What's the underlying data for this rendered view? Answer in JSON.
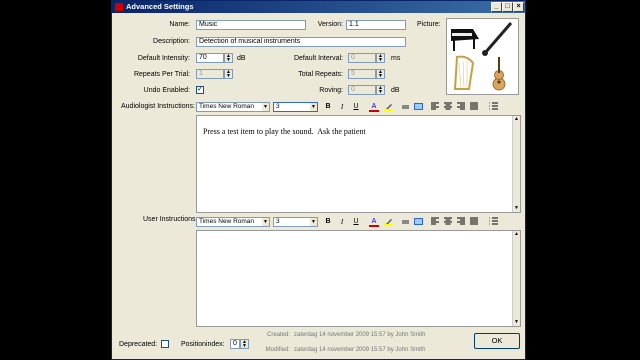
{
  "window": {
    "title": "Advanced Settings"
  },
  "form": {
    "name_label": "Name:",
    "name_value": "Music",
    "version_label": "Version:",
    "version_value": "1.1",
    "picture_label": "Picture:",
    "description_label": "Description:",
    "description_value": "Detection of musical instruments",
    "default_intensity_label": "Default Intensity:",
    "default_intensity_value": "70",
    "intensity_unit": "dB",
    "default_interval_label": "Default Interval:",
    "default_interval_value": "0",
    "interval_unit": "ms",
    "repeats_per_trial_label": "Repeats Per Trial:",
    "repeats_per_trial_value": "1",
    "total_repeats_label": "Total Repeats:",
    "total_repeats_value": "5",
    "undo_enabled_label": "Undo Enabled:",
    "undo_check": "✓",
    "roving_label": "Roving:",
    "roving_value": "0",
    "roving_unit": "dB"
  },
  "audiologist": {
    "label": "Audiologist Instructions:",
    "font": "Times New Roman",
    "size": "3",
    "text": "Press a test item to play the sound.  Ask the patient "
  },
  "user": {
    "label": "User Instructions:",
    "font": "Times New Roman",
    "size": "3",
    "text": ""
  },
  "toolbar": {
    "bold": "B",
    "italic": "I",
    "underline": "U",
    "font_color": "A"
  },
  "footer": {
    "deprecated_label": "Deprecated:",
    "position_index_label": "Positionindex:",
    "position_index_value": "0",
    "created_label": "Created:",
    "created_value": "zaterdag 14 november 2009 15:57 by John Smith",
    "modified_label": "Modified:",
    "modified_value": "zaterdag 14 november 2009 15:57 by John Smith",
    "ok_label": "OK"
  }
}
